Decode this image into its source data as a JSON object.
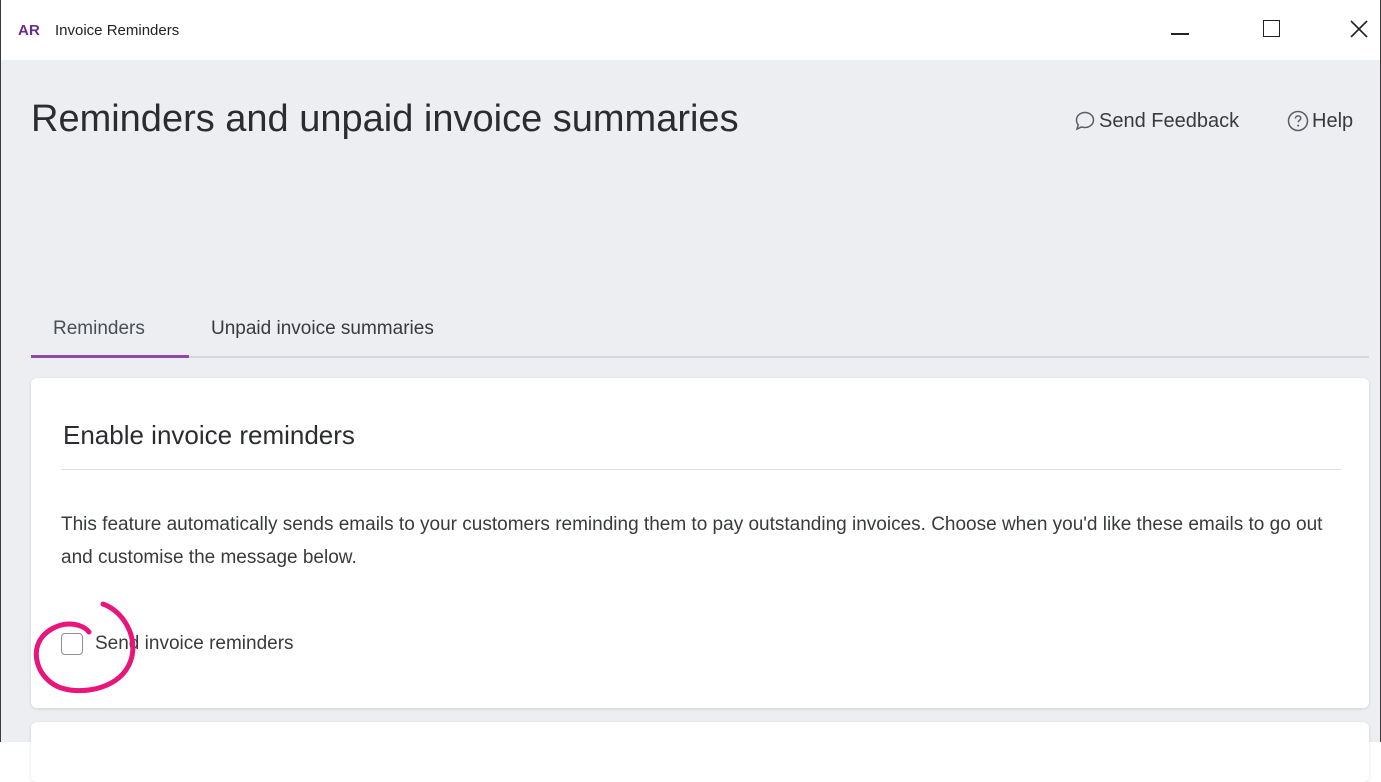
{
  "window": {
    "logo": "AR",
    "title": "Invoice Reminders"
  },
  "header": {
    "page_title": "Reminders and unpaid invoice summaries",
    "feedback_label": "Send Feedback",
    "help_label": "Help"
  },
  "tabs": [
    {
      "label": "Reminders",
      "active": true
    },
    {
      "label": "Unpaid invoice summaries",
      "active": false
    }
  ],
  "card": {
    "title": "Enable invoice reminders",
    "description": "This feature automatically sends emails to your customers reminding them to pay outstanding invoices. Choose when you'd like these emails to go out and customise the message below.",
    "checkbox_label": "Send invoice reminders",
    "checkbox_checked": false
  },
  "colors": {
    "accent": "#8d4aa8",
    "logo": "#6b2c91",
    "annotation": "#e8157a",
    "background": "#eceef1"
  },
  "icons": {
    "feedback": "speech-bubble-icon",
    "help": "question-circle-icon",
    "minimize": "minimize-icon",
    "maximize": "maximize-icon",
    "close": "close-icon"
  }
}
